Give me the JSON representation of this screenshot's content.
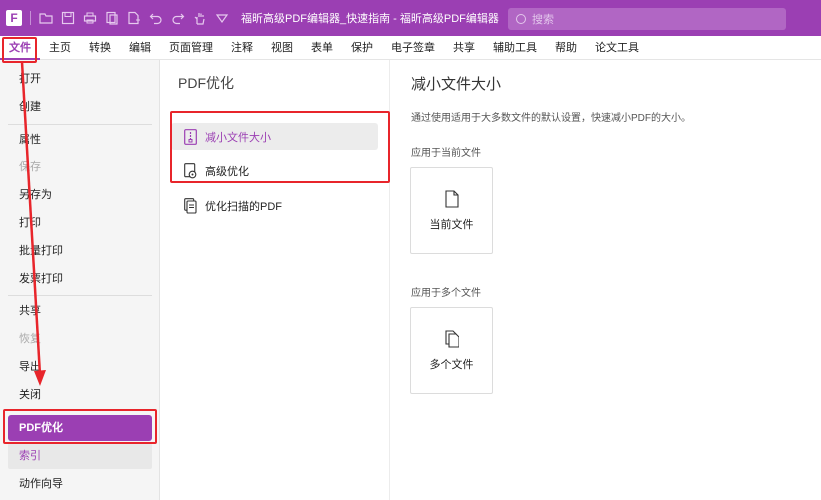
{
  "titlebar": {
    "logo": "F",
    "title": "福昕高级PDF编辑器_快速指南 - 福昕高级PDF编辑器",
    "search_placeholder": "搜索",
    "quick_icons": [
      "folder-icon",
      "save-icon",
      "print-icon",
      "pages-icon",
      "export-icon",
      "undo-icon",
      "redo-icon",
      "hand-icon",
      "dropdown-icon"
    ]
  },
  "menubar": {
    "items": [
      "文件",
      "主页",
      "转换",
      "编辑",
      "页面管理",
      "注释",
      "视图",
      "表单",
      "保护",
      "电子签章",
      "共享",
      "辅助工具",
      "帮助",
      "论文工具"
    ],
    "active": "文件"
  },
  "sidebar": {
    "items": [
      {
        "label": "打开",
        "state": "normal"
      },
      {
        "label": "创建",
        "state": "normal"
      },
      {
        "label": "属性",
        "state": "normal"
      },
      {
        "label": "保存",
        "state": "disabled"
      },
      {
        "label": "另存为",
        "state": "normal"
      },
      {
        "label": "打印",
        "state": "normal"
      },
      {
        "label": "批量打印",
        "state": "normal"
      },
      {
        "label": "发票打印",
        "state": "normal"
      },
      {
        "label": "共享",
        "state": "normal"
      },
      {
        "label": "恢复",
        "state": "disabled"
      },
      {
        "label": "导出",
        "state": "normal"
      },
      {
        "label": "关闭",
        "state": "normal"
      },
      {
        "label": "PDF优化",
        "state": "selected"
      },
      {
        "label": "索引",
        "state": "highlight"
      },
      {
        "label": "动作向导",
        "state": "normal"
      }
    ]
  },
  "midpanel": {
    "title": "PDF优化",
    "options": [
      {
        "label": "减小文件大小",
        "active": true
      },
      {
        "label": "高级优化",
        "active": false
      },
      {
        "label": "优化扫描的PDF",
        "active": false
      }
    ]
  },
  "rightpanel": {
    "title": "减小文件大小",
    "description": "通过使用适用于大多数文件的默认设置，快速减小PDF的大小。",
    "current_label": "应用于当前文件",
    "current_button": "当前文件",
    "multi_label": "应用于多个文件",
    "multi_button": "多个文件"
  },
  "colors": {
    "brand": "#9b3fb3",
    "annotation": "#e8252b"
  }
}
